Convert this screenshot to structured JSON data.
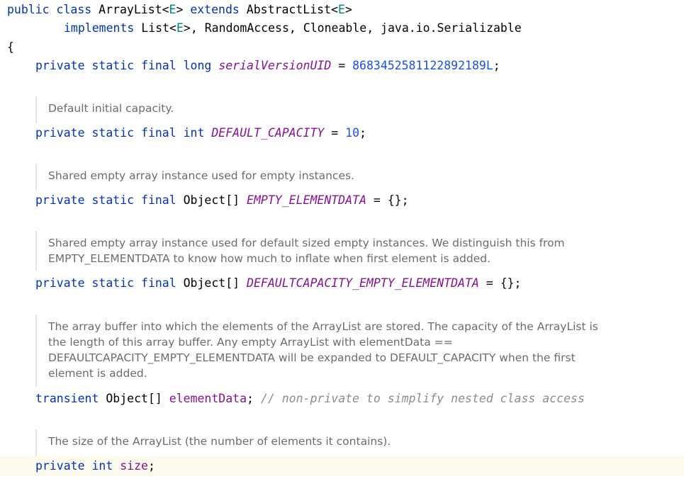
{
  "class_decl": {
    "kw_public": "public",
    "kw_class": "class",
    "class_name": "ArrayList",
    "lt": "<",
    "type_param": "E",
    "gt": ">",
    "kw_extends": "extends",
    "superclass": "AbstractList",
    "super_type_param": "E",
    "kw_implements": "implements",
    "iface_list": "List",
    "iface_type_param": "E",
    "rest_ifaces": ", RandomAccess, Cloneable, java.io.Serializable",
    "open_brace": "{"
  },
  "members": {
    "serial": {
      "modifiers": "private static final",
      "type": "long",
      "name": "serialVersionUID",
      "eq": " = ",
      "value": "8683452581122892189L",
      "semi": ";"
    },
    "default_capacity": {
      "doc": [
        "Default initial capacity."
      ],
      "modifiers": "private static final",
      "type": "int",
      "name": "DEFAULT_CAPACITY",
      "eq": " = ",
      "value": "10",
      "semi": ";"
    },
    "empty_elementdata": {
      "doc": [
        "Shared empty array instance used for empty instances."
      ],
      "modifiers": "private static final",
      "type": "Object[]",
      "name": "EMPTY_ELEMENTDATA",
      "eq": " = ",
      "value": "{};"
    },
    "defaultcapacity_empty": {
      "doc": [
        "Shared empty array instance used for default sized empty instances. We distinguish this from",
        "EMPTY_ELEMENTDATA to know how much to inflate when first element is added."
      ],
      "modifiers": "private static final",
      "type": "Object[]",
      "name": "DEFAULTCAPACITY_EMPTY_ELEMENTDATA",
      "eq": " = ",
      "value": "{};"
    },
    "element_data": {
      "doc": [
        "The array buffer into which the elements of the ArrayList are stored. The capacity of the ArrayList is",
        "the length of this array buffer. Any empty ArrayList with elementData ==",
        "DEFAULTCAPACITY_EMPTY_ELEMENTDATA will be expanded to DEFAULT_CAPACITY when the first",
        "element is added."
      ],
      "modifier": "transient",
      "type": "Object[]",
      "name": "elementData",
      "semi": ";",
      "comment": "// non-private to simplify nested class access"
    },
    "size": {
      "doc": [
        "The size of the ArrayList (the number of elements it contains)."
      ],
      "modifiers": "private",
      "type": "int",
      "name": "size",
      "semi": ";"
    }
  }
}
